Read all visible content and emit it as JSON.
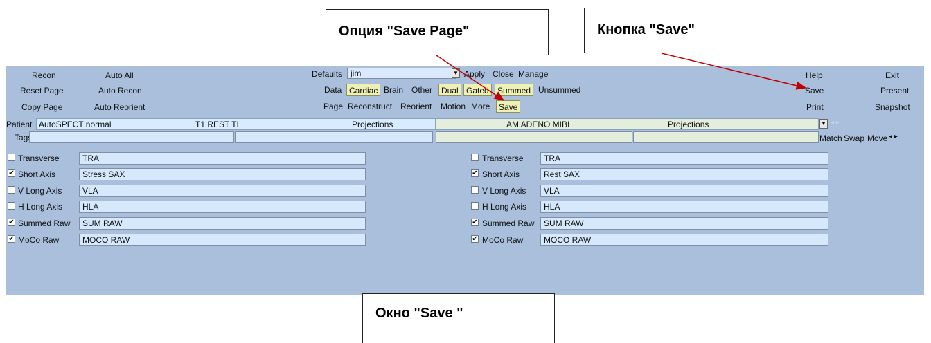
{
  "callouts": {
    "save_page": "Опция \"Save Page\"",
    "save_button": "Кнопка \"Save\"",
    "save_window": "Окно \"Save \""
  },
  "toolbar": {
    "left_col1": [
      "Recon",
      "Reset Page",
      "Copy Page"
    ],
    "left_col2": [
      "Auto All",
      "Auto Recon",
      "Auto Reorient"
    ],
    "defaults_label": "Defaults",
    "defaults_value": "jim",
    "apply": "Apply",
    "close": "Close",
    "manage": "Manage",
    "data_label": "Data",
    "data_options": [
      "Cardiac",
      "Brain",
      "Other"
    ],
    "data_options2": [
      "Dual",
      "Gated",
      "Summed",
      "Unsummed"
    ],
    "page_label": "Page",
    "page_options": [
      "Reconstruct",
      "Reorient",
      "Motion",
      "More"
    ],
    "save_chip": "Save",
    "right_col1": [
      "Help",
      "Save",
      "Print"
    ],
    "right_col2": [
      "Exit",
      "Present",
      "Snapshot"
    ]
  },
  "patient": {
    "label": "Patient",
    "name": "AutoSPECT normal",
    "study1": "T1 REST TL",
    "type1": "Projections",
    "study2": "AM ADENO MIBI",
    "type2": "Projections"
  },
  "tags": {
    "label": "Tags",
    "match": "Match",
    "swap": "Swap",
    "move": "Move"
  },
  "left_rows": [
    {
      "label": "Transverse",
      "value": "TRA",
      "checked": false
    },
    {
      "label": "Short Axis",
      "value": "Stress SAX",
      "checked": true
    },
    {
      "label": "V Long Axis",
      "value": "VLA",
      "checked": false
    },
    {
      "label": "H Long Axis",
      "value": "HLA",
      "checked": false
    },
    {
      "label": "Summed Raw",
      "value": "SUM RAW",
      "checked": true
    },
    {
      "label": "MoCo Raw",
      "value": "MOCO RAW",
      "checked": true
    }
  ],
  "right_rows": [
    {
      "label": "Transverse",
      "value": "TRA",
      "checked": false
    },
    {
      "label": "Short Axis",
      "value": "Rest SAX",
      "checked": true
    },
    {
      "label": "V Long Axis",
      "value": "VLA",
      "checked": false
    },
    {
      "label": "H Long Axis",
      "value": "HLA",
      "checked": false
    },
    {
      "label": "Summed Raw",
      "value": "SUM RAW",
      "checked": true
    },
    {
      "label": "MoCo Raw",
      "value": "MOCO RAW",
      "checked": true
    }
  ],
  "colors": {
    "panel_bg": "#a9bfdc",
    "chip_bg": "#eef0b4",
    "field_bg": "#d6e9fc",
    "arrow": "#c00000"
  }
}
